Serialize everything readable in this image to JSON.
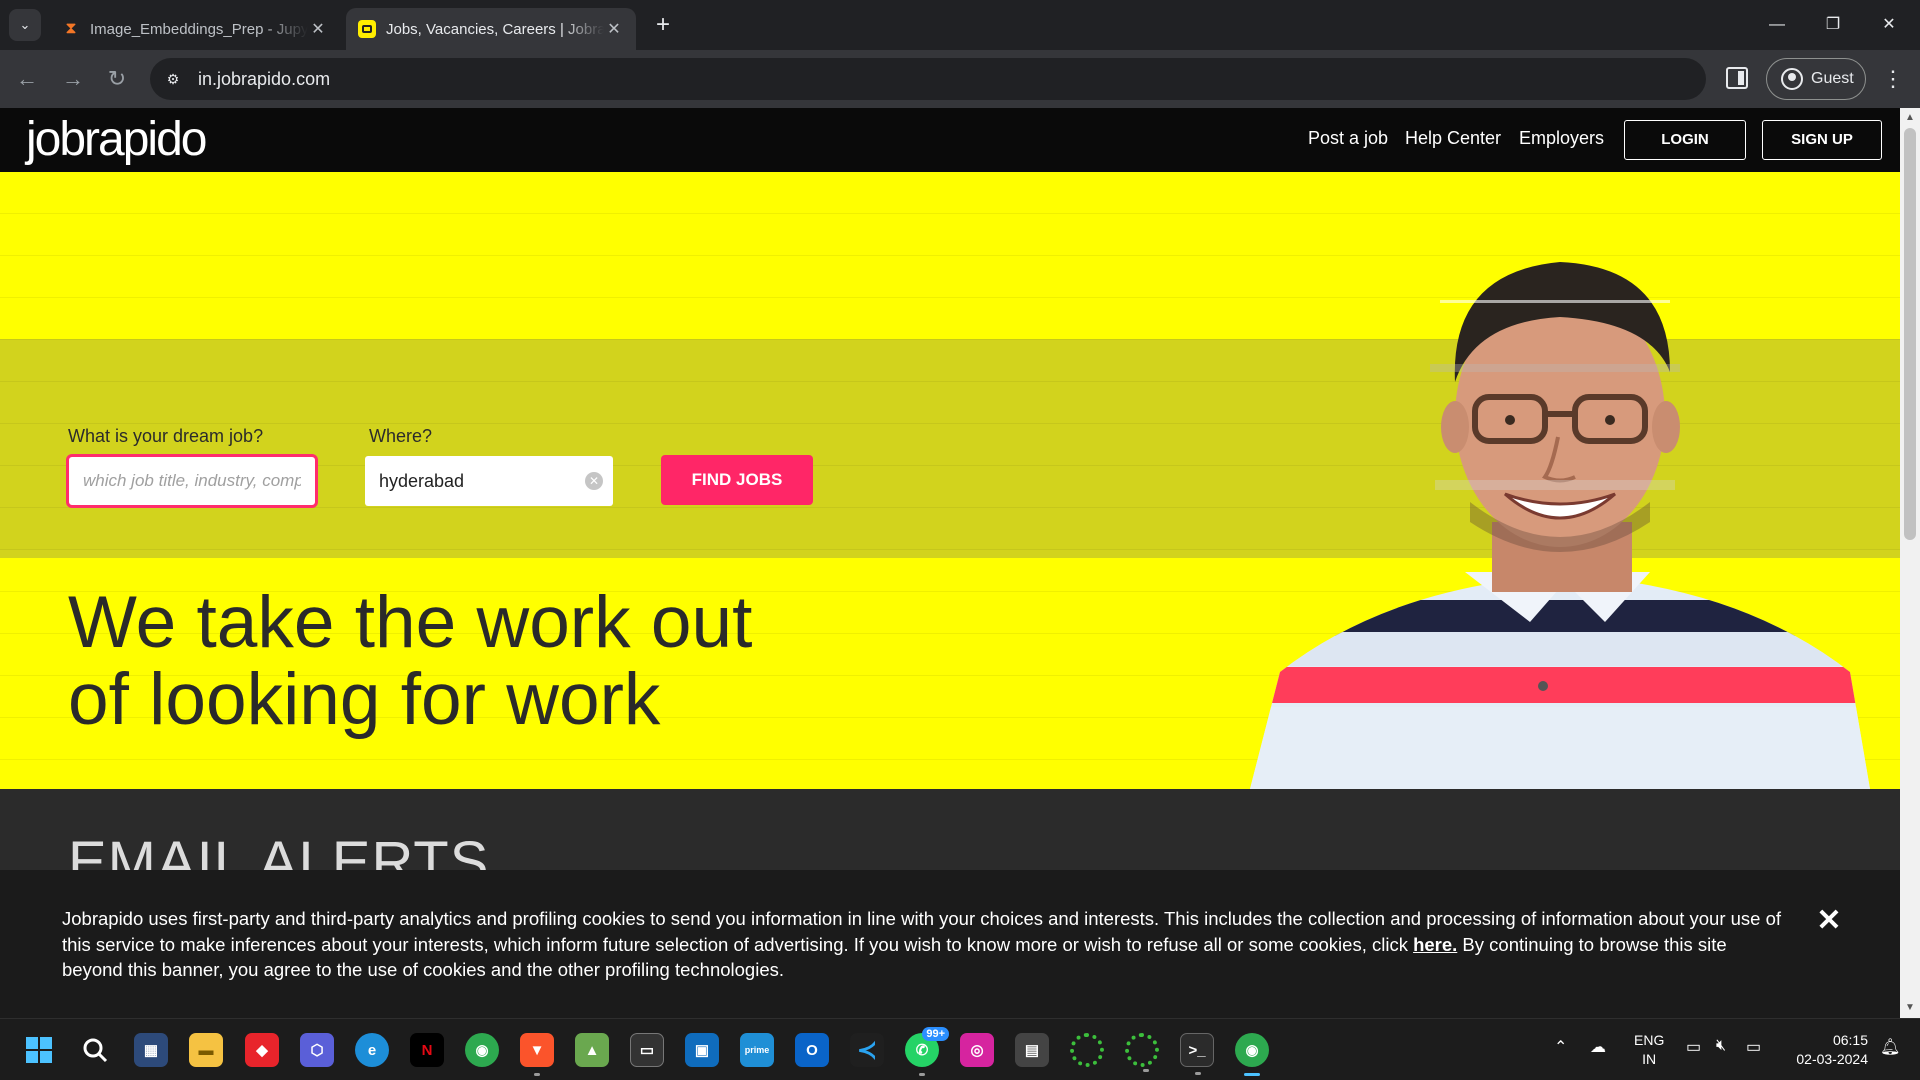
{
  "browser": {
    "tabs": [
      {
        "title": "Image_Embeddings_Prep - Jupyter",
        "icon": "hourglass-icon"
      },
      {
        "title": "Jobs, Vacancies, Careers | Jobrapido",
        "icon": "jobrapido-favicon"
      }
    ],
    "url": "in.jobrapido.com",
    "profile_label": "Guest"
  },
  "site": {
    "logo": "jobrapido",
    "nav": {
      "post_job": "Post a job",
      "help_center": "Help Center",
      "employers": "Employers",
      "login": "LOGIN",
      "signup": "SIGN UP"
    },
    "search": {
      "job_label": "What is your dream job?",
      "job_placeholder": "which job title, industry, company?",
      "where_label": "Where?",
      "where_value": "hyderabad",
      "find_button": "FIND JOBS"
    },
    "headline_line1": "We take the work out",
    "headline_line2": "of looking for work",
    "email_alerts_title": "EMAIL ALERTS"
  },
  "cookie_banner": {
    "text_before": "Jobrapido uses first-party and third-party analytics and profiling cookies to send you information in line with your choices and interests. This includes the collection and processing of information about your use of this service to make inferences about your interests, which inform future selection of advertising. If you wish to know more or wish to refuse all or some cookies, click ",
    "link_text": "here.",
    "text_after": " By continuing to browse this site beyond this banner, you agree to the use of cookies and the other profiling technologies.",
    "close": "✕"
  },
  "taskbar": {
    "whatsapp_badge": "99+",
    "language_line1": "ENG",
    "language_line2": "IN",
    "time": "06:15",
    "date": "02-03-2024"
  },
  "colors": {
    "hero_yellow": "#ffff00",
    "hero_band": "#d2d31d",
    "accent_pink": "#ff2667",
    "header_black": "#0a0a0a"
  }
}
